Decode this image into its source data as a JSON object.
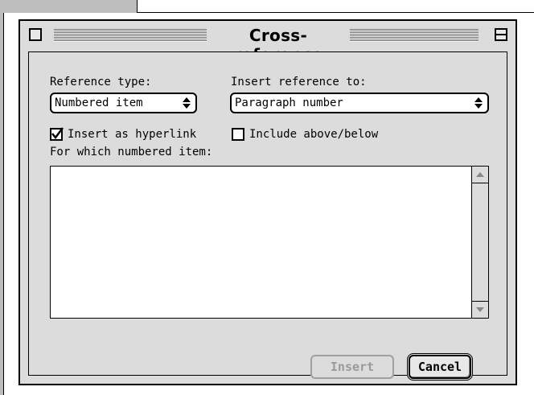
{
  "window": {
    "title": "Cross-reference"
  },
  "reference_type": {
    "label": "Reference type:",
    "selected": "Numbered item"
  },
  "insert_reference_to": {
    "label": "Insert reference to:",
    "selected": "Paragraph number"
  },
  "options": {
    "insert_as_hyperlink": {
      "label": "Insert as hyperlink",
      "checked": true
    },
    "include_above_below": {
      "label": "Include above/below",
      "checked": false
    }
  },
  "list": {
    "label": "For which numbered item:",
    "items": []
  },
  "buttons": {
    "insert": "Insert",
    "cancel": "Cancel"
  }
}
